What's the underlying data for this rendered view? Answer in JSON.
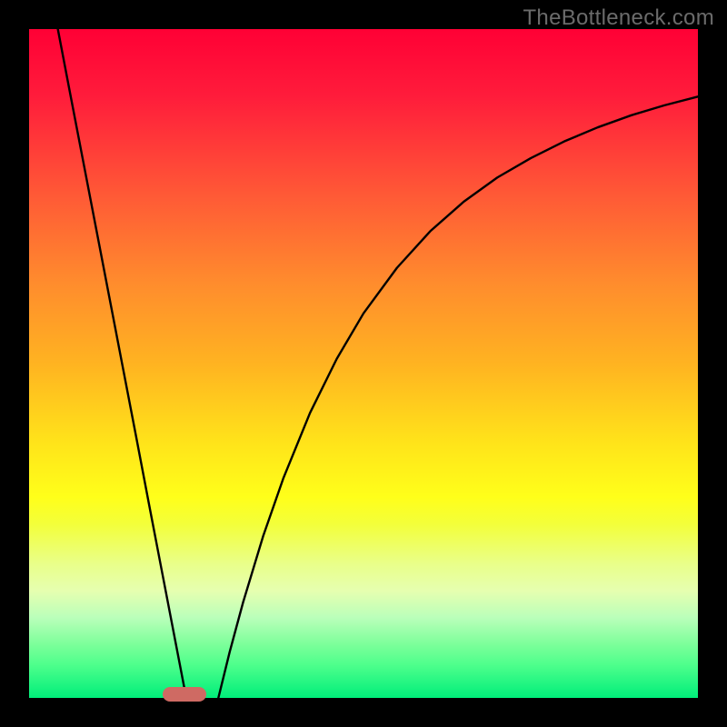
{
  "watermark": "TheBottleneck.com",
  "colors": {
    "background": "#000000",
    "marker": "#cf6a63",
    "curve_stroke": "#000000"
  },
  "chart_data": {
    "type": "line",
    "title": "",
    "xlabel": "",
    "ylabel": "",
    "xlim": [
      0,
      100
    ],
    "ylim": [
      0,
      100
    ],
    "series": [
      {
        "name": "left-branch",
        "x": [
          4.3,
          6,
          8,
          10,
          12,
          14,
          16,
          18,
          20,
          22,
          23.5
        ],
        "values": [
          100,
          91.1,
          80.7,
          70.3,
          59.9,
          49.5,
          39.1,
          28.6,
          18.2,
          7.8,
          0
        ]
      },
      {
        "name": "right-branch",
        "x": [
          28.3,
          30,
          32,
          35,
          38,
          42,
          46,
          50,
          55,
          60,
          65,
          70,
          75,
          80,
          85,
          90,
          95,
          100
        ],
        "values": [
          0,
          6.9,
          14.3,
          24.2,
          32.8,
          42.6,
          50.7,
          57.5,
          64.3,
          69.8,
          74.2,
          77.8,
          80.7,
          83.2,
          85.3,
          87.1,
          88.6,
          89.9
        ]
      }
    ],
    "marker": {
      "x_center": 23.2,
      "width_pct": 6.5
    }
  }
}
